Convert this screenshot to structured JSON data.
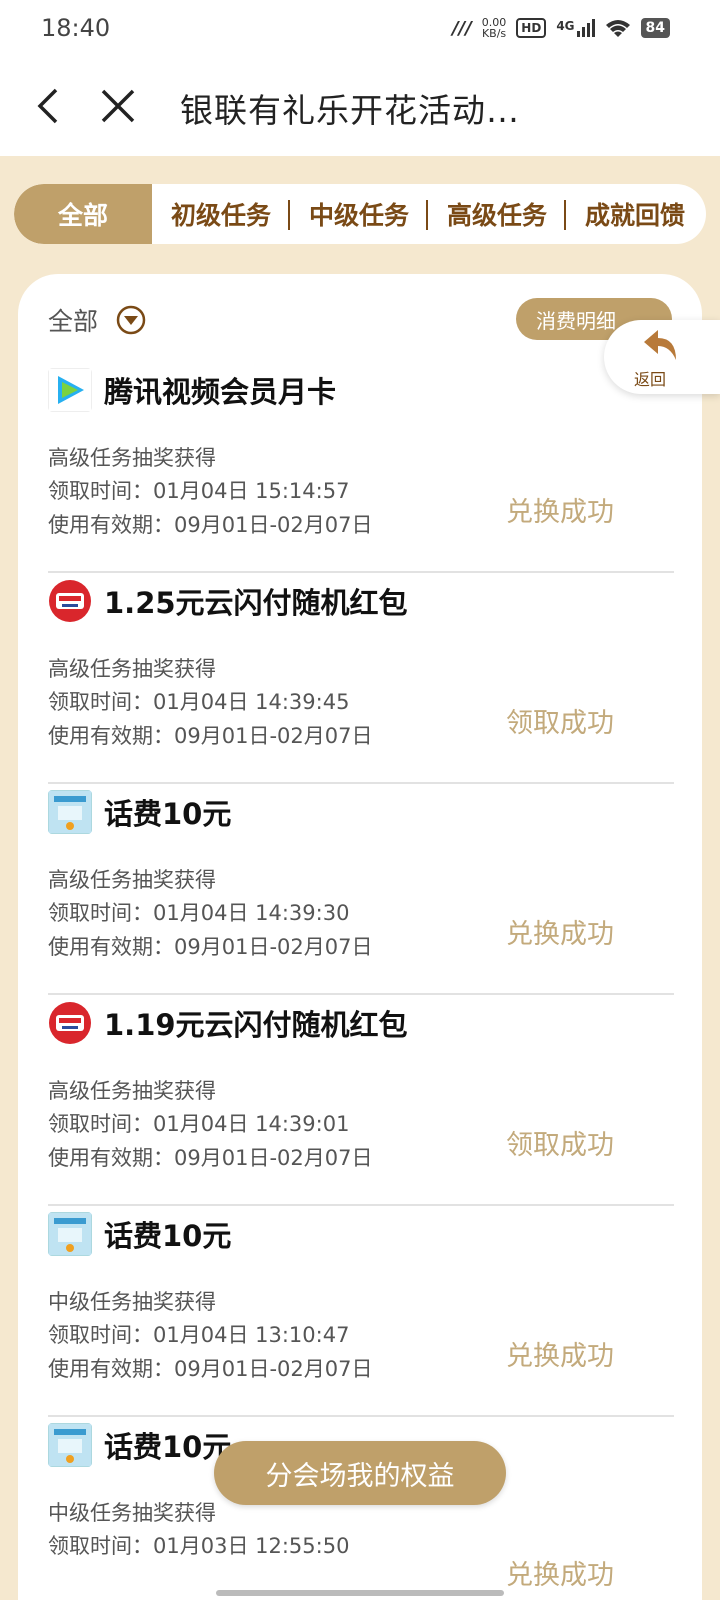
{
  "status": {
    "time": "18:40",
    "speed_value": "0.00",
    "speed_unit": "KB/s",
    "hd": "HD",
    "network": "4G",
    "battery": "84"
  },
  "header": {
    "title": "银联有礼乐开花活动…"
  },
  "tabs": [
    {
      "label": "全部",
      "active": true
    },
    {
      "label": "初级任务"
    },
    {
      "label": "中级任务"
    },
    {
      "label": "高级任务"
    },
    {
      "label": "成就回馈"
    }
  ],
  "filter": {
    "label": "全部"
  },
  "detail_button": {
    "label": "消费明细"
  },
  "float_back": {
    "label": "返回"
  },
  "items": [
    {
      "title": "腾讯视频会员月卡",
      "source": "高级任务抽奖获得",
      "time": "领取时间：01月04日 15:14:57",
      "validity": "使用有效期：09月01日-02月07日",
      "state": "兑换成功",
      "icon": "tencent-video-icon"
    },
    {
      "title": "1.25元云闪付随机红包",
      "source": "高级任务抽奖获得",
      "time": "领取时间：01月04日 14:39:45",
      "validity": "使用有效期：09月01日-02月07日",
      "state": "领取成功",
      "icon": "unionpay-icon"
    },
    {
      "title": "话费10元",
      "source": "高级任务抽奖获得",
      "time": "领取时间：01月04日 14:39:30",
      "validity": "使用有效期：09月01日-02月07日",
      "state": "兑换成功",
      "icon": "phone-bill-icon"
    },
    {
      "title": "1.19元云闪付随机红包",
      "source": "高级任务抽奖获得",
      "time": "领取时间：01月04日 14:39:01",
      "validity": "使用有效期：09月01日-02月07日",
      "state": "领取成功",
      "icon": "unionpay-icon"
    },
    {
      "title": "话费10元",
      "source": "中级任务抽奖获得",
      "time": "领取时间：01月04日 13:10:47",
      "validity": "使用有效期：09月01日-02月07日",
      "state": "兑换成功",
      "icon": "phone-bill-icon"
    },
    {
      "title": "话费10元",
      "source": "中级任务抽奖获得",
      "time": "领取时间：01月03日 12:55:50",
      "validity": "",
      "state": "兑换成功",
      "icon": "phone-bill-icon"
    }
  ],
  "bottom_button": {
    "label": "分会场我的权益"
  }
}
